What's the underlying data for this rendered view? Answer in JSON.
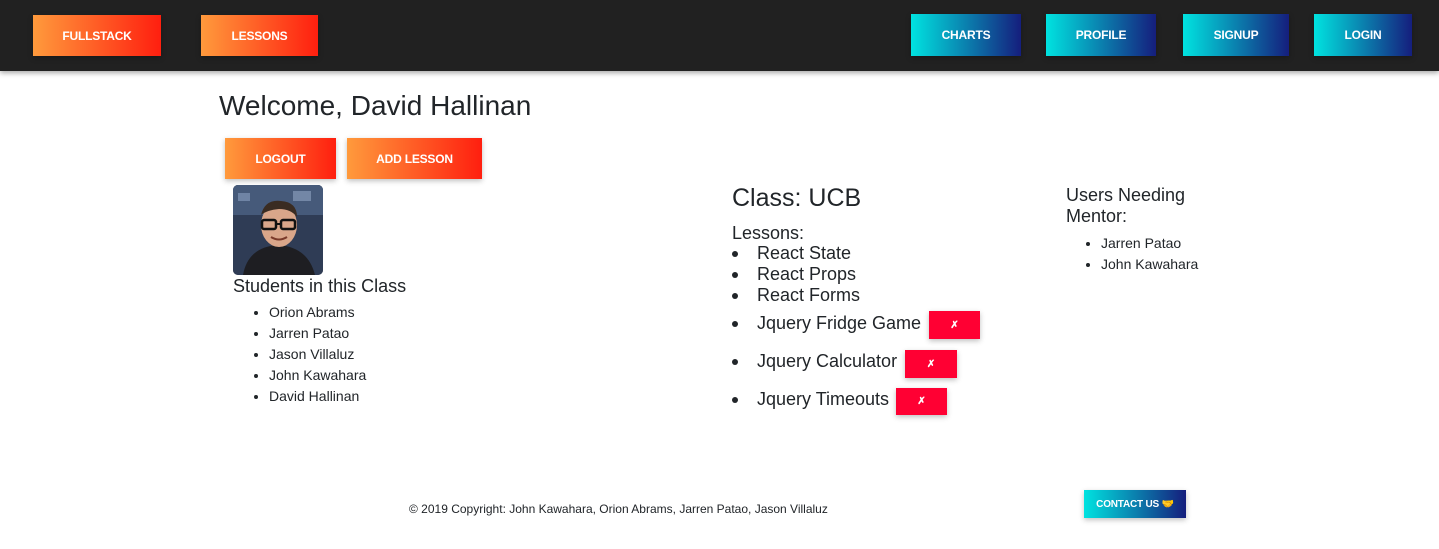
{
  "nav": {
    "left_buttons": [
      "FULLSTACK",
      "LESSONS"
    ],
    "right_buttons": [
      "CHARTS",
      "PROFILE",
      "SIGNUP",
      "LOGIN"
    ]
  },
  "welcome": {
    "title": "Welcome, David Hallinan"
  },
  "actions": {
    "logout_label": "LOGOUT",
    "add_lesson_label": "ADD LESSON"
  },
  "students": {
    "heading": "Students in this Class",
    "items": [
      "Orion Abrams",
      "Jarren Patao",
      "Jason Villaluz",
      "John Kawahara",
      "David Hallinan"
    ]
  },
  "class": {
    "title": "Class: UCB",
    "lessons_label": "Lessons:",
    "lessons": [
      {
        "name": "React State",
        "deletable": false
      },
      {
        "name": "React Props",
        "deletable": false
      },
      {
        "name": "React Forms",
        "deletable": false
      },
      {
        "name": "Jquery Fridge Game",
        "deletable": true
      },
      {
        "name": "Jquery Calculator",
        "deletable": true
      },
      {
        "name": "Jquery Timeouts",
        "deletable": true
      }
    ],
    "delete_label": "✗"
  },
  "mentor": {
    "heading_line1": "Users Needing",
    "heading_line2": "Mentor:",
    "items": [
      "Jarren Patao",
      "John Kawahara"
    ]
  },
  "footer": {
    "copyright": "© 2019 Copyright: John Kawahara, Orion Abrams, Jarren Patao, Jason Villaluz",
    "contact_label": "CONTACT US 🤝"
  },
  "colors": {
    "navbar": "#212121",
    "orange_start": "#ff9a3c",
    "orange_end": "#ff1f0f",
    "blue_start": "#00e3e0",
    "blue_end": "#151e7d",
    "delete_red": "#ff0033"
  }
}
